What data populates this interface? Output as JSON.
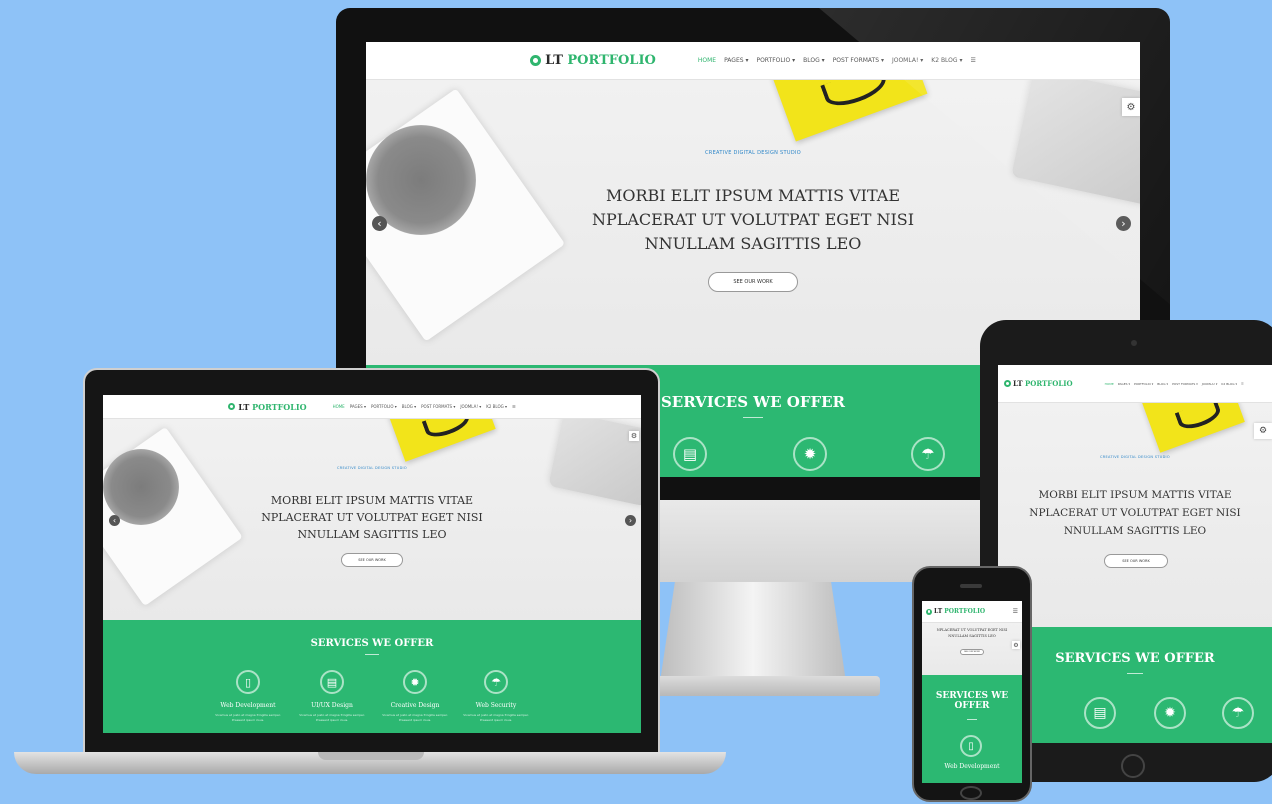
{
  "site": {
    "logo_prefix": "LT",
    "logo_name": "PORTFOLIO",
    "menu": [
      "HOME",
      "PAGES ▾",
      "PORTFOLIO ▾",
      "BLOG ▾",
      "POST FORMATS ▾",
      "JOOMLA! ▾",
      "K2 BLOG ▾",
      "☰"
    ],
    "eyebrow": "CREATIVE DIGITAL DESIGN STUDIO",
    "headline": [
      "MORBI ELIT IPSUM MATTIS VITAE",
      "NPLACERAT UT VOLUTPAT EGET NISI",
      "NNULLAM SAGITTIS LEO"
    ],
    "cta": "SEE OUR WORK",
    "services_title": "SERVICES WE OFFER",
    "services": [
      {
        "label": "Web Development",
        "icon": "mobile-icon",
        "glyph": "▯",
        "text": "Vivamus et justo et magna fringilla semper. Praesent ipsum risus."
      },
      {
        "label": "UI/UX Design",
        "icon": "document-icon",
        "glyph": "▤",
        "text": "Vivamus et justo et magna fringilla semper. Praesent ipsum risus."
      },
      {
        "label": "Creative Design",
        "icon": "gear-icon",
        "glyph": "✹",
        "text": "Vivamus et justo et magna fringilla semper. Praesent ipsum risus."
      },
      {
        "label": "Web Security",
        "icon": "umbrella-icon",
        "glyph": "☂",
        "text": "Vivamus et justo et magna fringilla semper. Praesent ipsum risus."
      }
    ],
    "phone_headline": [
      "NPLACERAT UT VOLUTPAT EGET NISI",
      "NNULLAM SAGITTIS LEO"
    ],
    "services_title_phone": [
      "SERVICES WE",
      "OFFER"
    ]
  },
  "colors": {
    "background": "#8ec2f7",
    "brand_green": "#2cb872",
    "eyebrow_blue": "#2d86c8"
  },
  "icons": {
    "prev": "‹",
    "next": "›",
    "settings": "⚙",
    "apple": ""
  }
}
